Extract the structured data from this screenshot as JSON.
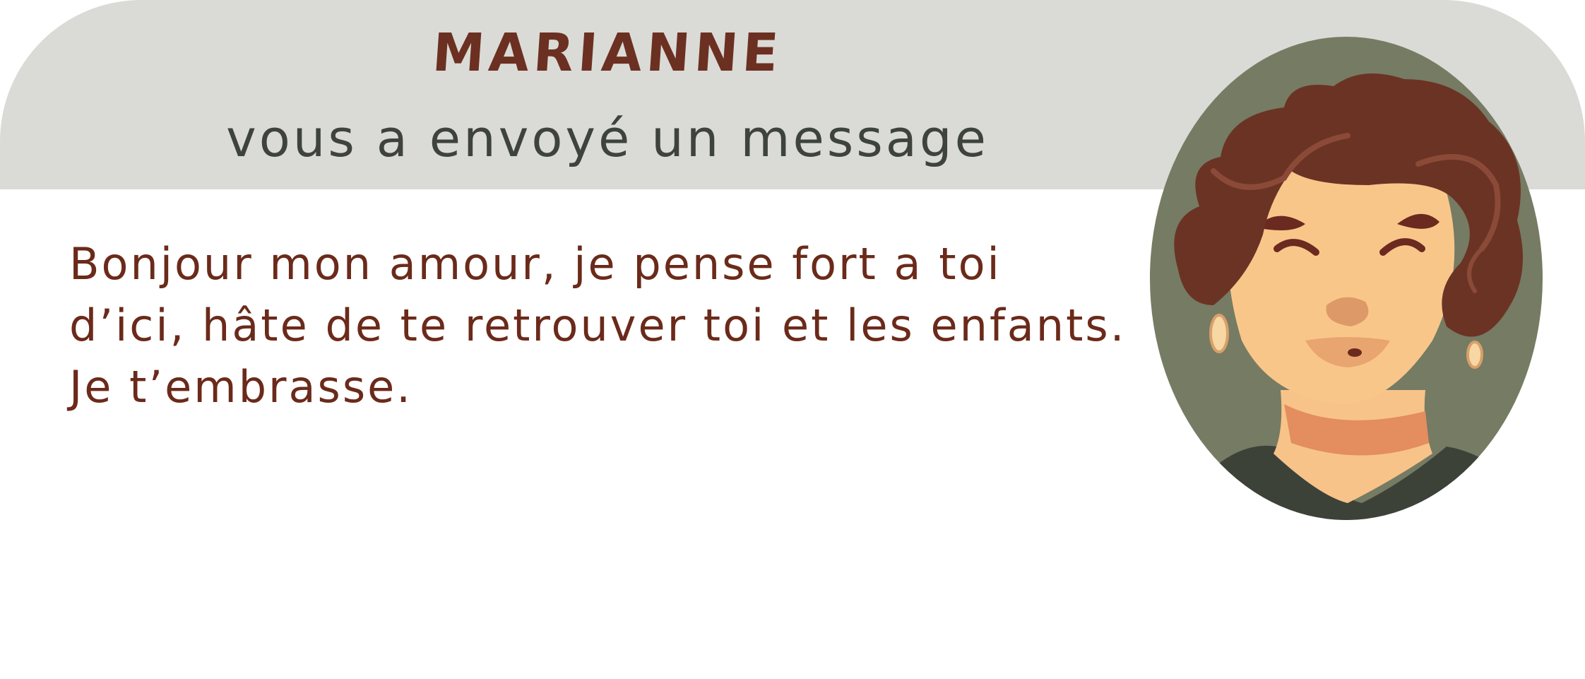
{
  "notification": {
    "sender_name": "MARIANNE",
    "subtitle": "vous a envoyé un message",
    "message_lines": [
      "Bonjour mon amour, je pense fort a toi",
      "d’ici, hâte de te retrouver toi et les enfants.",
      "Je t’embrasse."
    ]
  },
  "avatar": {
    "icon": "elderly-woman-portrait",
    "background_color": "#767b63"
  },
  "colors": {
    "header_background": "#dadbd6",
    "sender_name": "#6b3021",
    "subtitle": "#3e433d",
    "message_text": "#6b2a1a"
  }
}
